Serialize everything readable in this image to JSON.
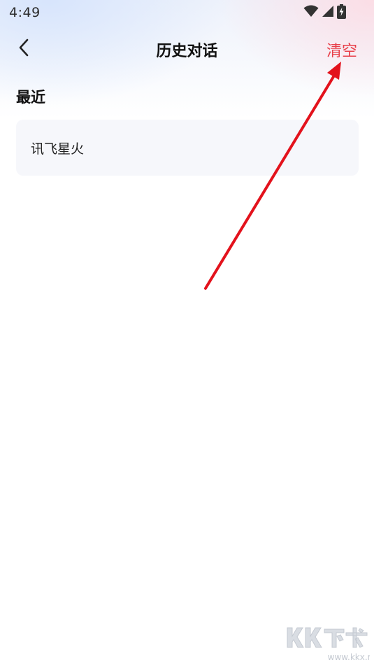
{
  "status_bar": {
    "time": "4:49",
    "icons": [
      "wifi-icon",
      "cellular-signal-icon",
      "battery-charging-icon"
    ]
  },
  "nav": {
    "back_icon": "chevron-left-icon",
    "title": "历史对话",
    "clear_label": "清空"
  },
  "section": {
    "title": "最近"
  },
  "history": {
    "items": [
      {
        "label": "讯飞星火"
      }
    ]
  },
  "colors": {
    "accent": "#e8404a",
    "annotation_arrow": "#e3121c",
    "card_background": "#f6f7fb"
  },
  "watermark": {
    "logo_text": "KK下载",
    "url": "www.kkx.net"
  }
}
